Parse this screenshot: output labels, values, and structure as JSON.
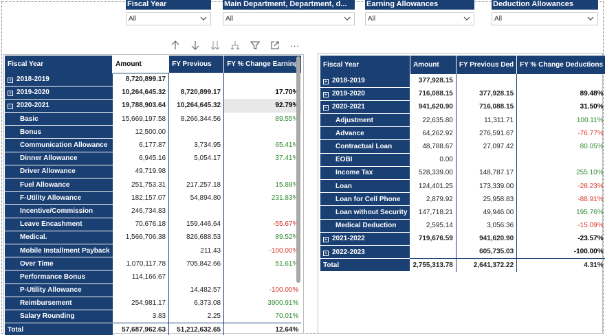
{
  "slicers": [
    {
      "title": "Fiscal Year",
      "value": "All"
    },
    {
      "title": "Main Department, Department, d...",
      "value": "All"
    },
    {
      "title": "Earning Allowances",
      "value": "All"
    },
    {
      "title": "Deduction Allowances",
      "value": "All"
    }
  ],
  "toolbar": {
    "icons": [
      "arrow-up-icon",
      "arrow-down-icon",
      "double-arrow-down-icon",
      "fork-icon",
      "filter-icon",
      "focus-mode-icon",
      "more-options-icon"
    ],
    "more_label": "···"
  },
  "earnings": {
    "headers": [
      "Fiscal Year",
      "Amount",
      "FY Previous",
      "FY % Change Earning"
    ],
    "rows": [
      {
        "label": "2018-2019",
        "level": 0,
        "expander": "+",
        "values": [
          "8,720,899.17",
          "",
          ""
        ],
        "dir": [
          "",
          "",
          ""
        ]
      },
      {
        "label": "2019-2020",
        "level": 0,
        "expander": "+",
        "values": [
          "10,264,645.32",
          "8,720,899.17",
          "17.70%"
        ],
        "dir": [
          "",
          "",
          "pos"
        ]
      },
      {
        "label": "2020-2021",
        "level": 0,
        "expander": "−",
        "values": [
          "19,788,903.64",
          "10,264,645.32",
          "92.79%"
        ],
        "dir": [
          "",
          "",
          "pos"
        ],
        "highlight": true
      },
      {
        "label": "Basic",
        "level": 1,
        "values": [
          "15,669,197.58",
          "8,266,344.56",
          "89.55%"
        ],
        "dir": [
          "",
          "",
          "pos"
        ]
      },
      {
        "label": "Bonus",
        "level": 1,
        "values": [
          "12,500.00",
          "",
          ""
        ],
        "dir": [
          "",
          "",
          ""
        ]
      },
      {
        "label": "Communication Allowance",
        "level": 1,
        "values": [
          "6,177.87",
          "3,734.95",
          "65.41%"
        ],
        "dir": [
          "",
          "",
          "pos"
        ]
      },
      {
        "label": "Dinner Allowance",
        "level": 1,
        "values": [
          "6,945.16",
          "5,054.17",
          "37.41%"
        ],
        "dir": [
          "",
          "",
          "pos"
        ]
      },
      {
        "label": "Driver Allowance",
        "level": 1,
        "values": [
          "49,719.98",
          "",
          ""
        ],
        "dir": [
          "",
          "",
          ""
        ]
      },
      {
        "label": "Fuel Allowance",
        "level": 1,
        "values": [
          "251,753.31",
          "217,257.18",
          "15.88%"
        ],
        "dir": [
          "",
          "",
          "pos"
        ]
      },
      {
        "label": "F-Utility Allowance",
        "level": 1,
        "values": [
          "182,157.07",
          "54,894.80",
          "231.83%"
        ],
        "dir": [
          "",
          "",
          "pos"
        ]
      },
      {
        "label": "Incentive/Commission",
        "level": 1,
        "values": [
          "246,734.83",
          "",
          ""
        ],
        "dir": [
          "",
          "",
          ""
        ]
      },
      {
        "label": "Leave Encashment",
        "level": 1,
        "values": [
          "70,676.18",
          "159,446.64",
          "-55.67%"
        ],
        "dir": [
          "",
          "",
          "neg"
        ]
      },
      {
        "label": "Medical.",
        "level": 1,
        "values": [
          "1,566,706.38",
          "826,688.53",
          "89.52%"
        ],
        "dir": [
          "",
          "",
          "pos"
        ]
      },
      {
        "label": "Mobile Installment Payback",
        "level": 1,
        "values": [
          "",
          "211.43",
          "-100.00%"
        ],
        "dir": [
          "",
          "",
          "neg"
        ]
      },
      {
        "label": "Over Time",
        "level": 1,
        "values": [
          "1,070,117.78",
          "705,842.66",
          "51.61%"
        ],
        "dir": [
          "",
          "",
          "pos"
        ]
      },
      {
        "label": "Performance Bonus",
        "level": 1,
        "values": [
          "114,166.67",
          "",
          ""
        ],
        "dir": [
          "",
          "",
          ""
        ]
      },
      {
        "label": "P-Utility Allowance",
        "level": 1,
        "values": [
          "",
          "14,482.57",
          "-100.00%"
        ],
        "dir": [
          "",
          "",
          "neg"
        ]
      },
      {
        "label": "Reimbursement",
        "level": 1,
        "values": [
          "254,981.17",
          "6,373.08",
          "3900.91%"
        ],
        "dir": [
          "",
          "",
          "pos"
        ]
      },
      {
        "label": "Salary Rounding",
        "level": 1,
        "values": [
          "3.83",
          "2.25",
          "70.01%"
        ],
        "dir": [
          "",
          "",
          "pos"
        ]
      }
    ],
    "total": {
      "label": "Total",
      "values": [
        "57,687,962.63",
        "51,212,632.65",
        "12.64%"
      ]
    }
  },
  "deductions": {
    "headers": [
      "Fiscal Year",
      "Amount",
      "FY Previous Ded",
      "FY % Change Deductions"
    ],
    "rows": [
      {
        "label": "2018-2019",
        "level": 0,
        "expander": "+",
        "values": [
          "377,928.15",
          "",
          ""
        ],
        "dir": [
          "",
          "",
          ""
        ]
      },
      {
        "label": "2019-2020",
        "level": 0,
        "expander": "+",
        "values": [
          "716,088.15",
          "377,928.15",
          "89.48%"
        ],
        "dir": [
          "",
          "",
          "pos"
        ]
      },
      {
        "label": "2020-2021",
        "level": 0,
        "expander": "−",
        "values": [
          "941,620.90",
          "716,088.15",
          "31.50%"
        ],
        "dir": [
          "",
          "",
          "pos"
        ]
      },
      {
        "label": "Adjustment",
        "level": 1,
        "values": [
          "22,635.80",
          "11,311.71",
          "100.11%"
        ],
        "dir": [
          "",
          "",
          "pos"
        ]
      },
      {
        "label": "Advance",
        "level": 1,
        "values": [
          "64,262.92",
          "276,591.67",
          "-76.77%"
        ],
        "dir": [
          "",
          "",
          "neg"
        ]
      },
      {
        "label": "Contractual Loan",
        "level": 1,
        "values": [
          "48,788.67",
          "27,097.42",
          "80.05%"
        ],
        "dir": [
          "",
          "",
          "pos"
        ]
      },
      {
        "label": "EOBI",
        "level": 1,
        "values": [
          "0.00",
          "",
          ""
        ],
        "dir": [
          "",
          "",
          ""
        ]
      },
      {
        "label": "Income Tax",
        "level": 1,
        "values": [
          "528,339.00",
          "148,787.17",
          "255.10%"
        ],
        "dir": [
          "",
          "",
          "pos"
        ]
      },
      {
        "label": "Loan",
        "level": 1,
        "values": [
          "124,401.25",
          "173,339.00",
          "-28.23%"
        ],
        "dir": [
          "",
          "",
          "neg"
        ]
      },
      {
        "label": "Loan for Cell Phone",
        "level": 1,
        "values": [
          "2,879.92",
          "25,958.83",
          "-88.91%"
        ],
        "dir": [
          "",
          "",
          "neg"
        ]
      },
      {
        "label": "Loan without Security",
        "level": 1,
        "values": [
          "147,718.21",
          "49,946.00",
          "195.76%"
        ],
        "dir": [
          "",
          "",
          "pos"
        ]
      },
      {
        "label": "Medical Deduction",
        "level": 1,
        "values": [
          "2,595.14",
          "3,056.36",
          "-15.09%"
        ],
        "dir": [
          "",
          "",
          "neg"
        ]
      },
      {
        "label": "2021-2022",
        "level": 0,
        "expander": "+",
        "values": [
          "719,676.59",
          "941,620.90",
          "-23.57%"
        ],
        "dir": [
          "",
          "",
          "neg"
        ]
      },
      {
        "label": "2022-2023",
        "level": 0,
        "expander": "+",
        "values": [
          "",
          "605,735.03",
          "-100.00%"
        ],
        "dir": [
          "",
          "",
          "neg"
        ]
      }
    ],
    "total": {
      "label": "Total",
      "values": [
        "2,755,313.78",
        "2,641,372.22",
        "4.31%"
      ]
    }
  },
  "colors": {
    "header_bg": "#1a3f73",
    "positive": "#2e8b2e",
    "negative": "#d6362a"
  }
}
